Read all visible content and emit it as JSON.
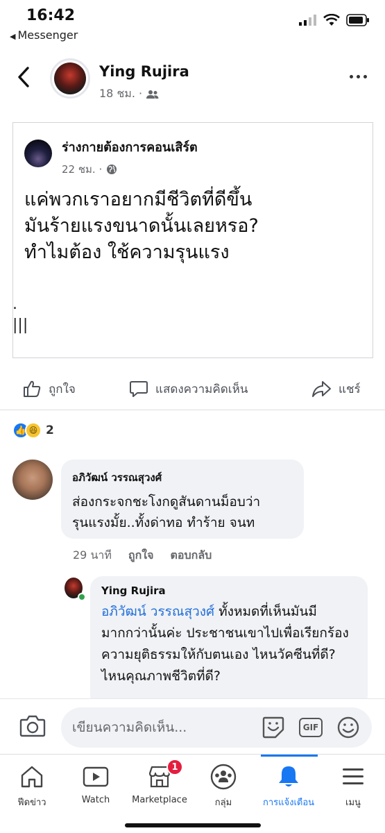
{
  "status": {
    "time": "16:42",
    "back_app": "Messenger"
  },
  "post": {
    "author": "Ying Rujira",
    "time": "18 ชม. ·"
  },
  "shared": {
    "page_name": "ร่างกายต้องการคอนเสิร์ต",
    "time": "22 ชม. ·",
    "text": "แค่พวกเราอยากมีชีวิตที่ดีขึ้น\nมันร้ายแรงขนาดนั้นเลยหรอ?\nทำไมต้อง ใช้ความรุนแรง",
    "tail": ".\n|||"
  },
  "actions": {
    "like": "ถูกใจ",
    "comment": "แสดงความคิดเห็น",
    "share": "แชร์"
  },
  "reactions": {
    "count": "2"
  },
  "comment1": {
    "name": "อภิวัฒน์ วรรณสุวงศ์",
    "text": "ส่องกระจกชะโงกดูสันดานม็อบว่า\nรุนแรงมั้ย..ทั้งด่าทอ ทำร้าย จนท",
    "time": "29 นาที",
    "like": "ถูกใจ",
    "reply": "ตอบกลับ"
  },
  "comment2": {
    "name": "Ying Rujira",
    "mention": "อภิวัฒน์ วรรณสุวงศ์",
    "text": " ทั้งหมดที่เห็นมันมีมากกว่านั้นค่ะ  ประชาชนเขาไปเพื่อเรียกร้องความยุติธรรมให้กับตนเอง ไหนวัคซีนที่ดี? ไหนคุณภาพชีวิตที่ดี?"
  },
  "composer": {
    "placeholder": "เขียนความคิดเห็น...",
    "gif": "GIF"
  },
  "tabs": [
    {
      "label": "ฟีดข่าว",
      "icon": "home-icon"
    },
    {
      "label": "Watch",
      "icon": "watch-icon"
    },
    {
      "label": "Marketplace",
      "icon": "marketplace-icon",
      "badge": "1"
    },
    {
      "label": "กลุ่ม",
      "icon": "groups-icon"
    },
    {
      "label": "การแจ้งเตือน",
      "icon": "bell-icon",
      "active": true
    },
    {
      "label": "เมนู",
      "icon": "menu-icon"
    }
  ],
  "colors": {
    "accent": "#1877f2",
    "mention": "#216fdb",
    "badge": "#e41e3f",
    "bubble": "#f0f2f5"
  }
}
